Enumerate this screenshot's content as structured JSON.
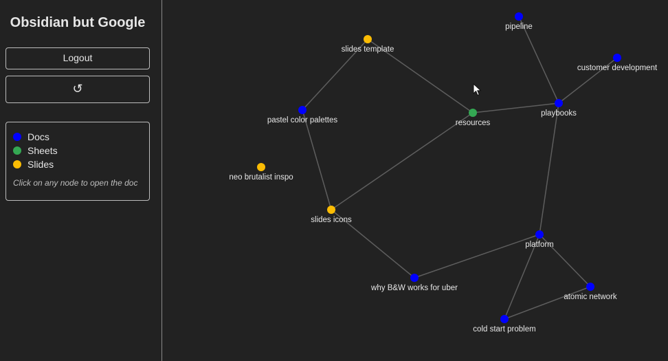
{
  "app": {
    "title": "Obsidian but Google"
  },
  "sidebar": {
    "logout_label": "Logout",
    "refresh_icon": "↺"
  },
  "legend": {
    "items": [
      {
        "label": "Docs",
        "color": "#0000ff"
      },
      {
        "label": "Sheets",
        "color": "#34a853"
      },
      {
        "label": "Slides",
        "color": "#fbbc04"
      }
    ],
    "hint": "Click on any node to open the doc"
  },
  "graph": {
    "nodes": [
      {
        "id": "pipeline",
        "label": "pipeline",
        "type": "doc"
      },
      {
        "id": "customer-development",
        "label": "customer development",
        "type": "doc"
      },
      {
        "id": "slides-template",
        "label": "slides template",
        "type": "slide"
      },
      {
        "id": "pastel-color-palettes",
        "label": "pastel color palettes",
        "type": "doc"
      },
      {
        "id": "resources",
        "label": "resources",
        "type": "sheet"
      },
      {
        "id": "playbooks",
        "label": "playbooks",
        "type": "doc"
      },
      {
        "id": "neo-brutalist-inspo",
        "label": "neo brutalist inspo",
        "type": "slide"
      },
      {
        "id": "slides-icons",
        "label": "slides icons",
        "type": "slide"
      },
      {
        "id": "platform",
        "label": "platform",
        "type": "doc"
      },
      {
        "id": "why-bw-works-for-uber",
        "label": "why B&W works for uber",
        "type": "doc"
      },
      {
        "id": "atomic-network",
        "label": "atomic network",
        "type": "doc"
      },
      {
        "id": "cold-start-problem",
        "label": "cold start problem",
        "type": "doc"
      }
    ],
    "edges": [
      [
        "pipeline",
        "playbooks"
      ],
      [
        "customer-development",
        "playbooks"
      ],
      [
        "resources",
        "playbooks"
      ],
      [
        "slides-template",
        "resources"
      ],
      [
        "slides-template",
        "pastel-color-palettes"
      ],
      [
        "pastel-color-palettes",
        "slides-icons"
      ],
      [
        "resources",
        "slides-icons"
      ],
      [
        "playbooks",
        "platform"
      ],
      [
        "slides-icons",
        "why-bw-works-for-uber"
      ],
      [
        "why-bw-works-for-uber",
        "platform"
      ],
      [
        "platform",
        "atomic-network"
      ],
      [
        "platform",
        "cold-start-problem"
      ],
      [
        "atomic-network",
        "cold-start-problem"
      ]
    ]
  }
}
